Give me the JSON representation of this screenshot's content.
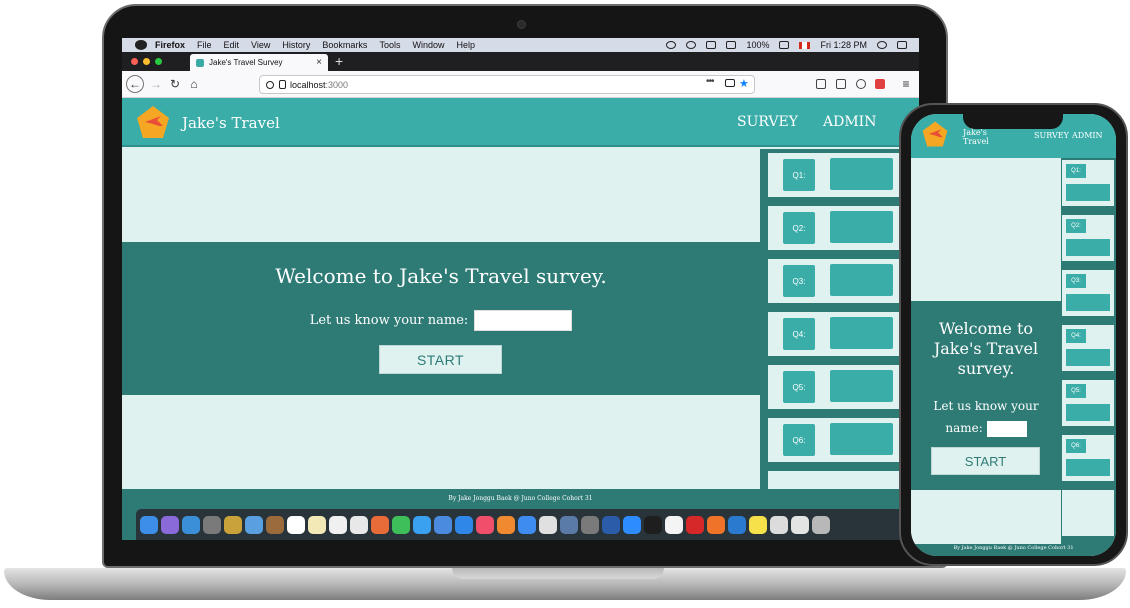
{
  "mac_menubar": {
    "app": "Firefox",
    "menus": [
      "File",
      "Edit",
      "View",
      "History",
      "Bookmarks",
      "Tools",
      "Window",
      "Help"
    ],
    "battery": "100%",
    "clock": "Fri 1:28 PM"
  },
  "browser": {
    "tab_title": "Jake's Travel Survey",
    "url_host": "localhost",
    "url_port": ":3000"
  },
  "site": {
    "brand": "Jake's Travel",
    "nav": {
      "survey": "SURVEY",
      "admin": "ADMIN"
    },
    "hero_title": "Welcome to Jake's Travel survey.",
    "name_label": "Let us know your name:",
    "start_label": "START",
    "footer": "By Jake Jonggu Baek @ Juno College Cohort 31",
    "questions": [
      "Q1:",
      "Q2:",
      "Q3:",
      "Q4:",
      "Q5:",
      "Q6:"
    ],
    "colors": {
      "teal": "#3aada8",
      "dark_teal": "#2e7b76",
      "light": "#dff2f0"
    }
  },
  "mobile": {
    "brand": "Jake's Travel",
    "survey": "SURVEY",
    "admin": "ADMIN",
    "hero_title": "Welcome to Jake's Travel survey.",
    "name_label": "Let us know your name:",
    "start_label": "START",
    "footer": "By Jake Jonggu Baek @ Juno College Cohort 31",
    "questions": [
      "Q1:",
      "Q2:",
      "Q3:",
      "Q4:",
      "Q5:",
      "Q6:"
    ]
  }
}
